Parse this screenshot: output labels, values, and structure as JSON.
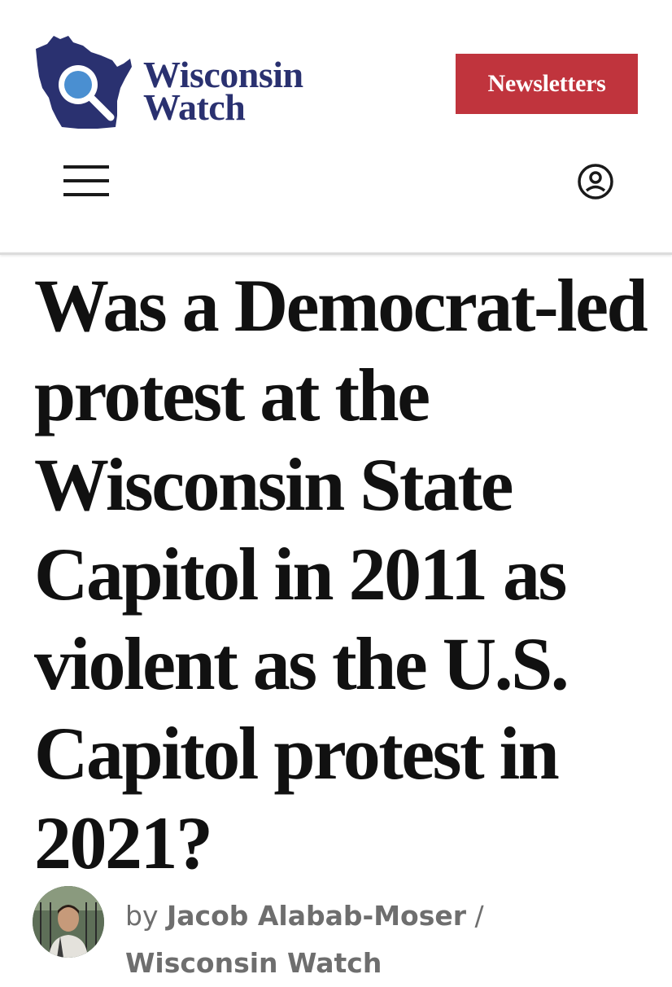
{
  "brand": {
    "line1": "Wisconsin",
    "line2": "Watch",
    "color": "#2a3170"
  },
  "header": {
    "newsletters_label": "Newsletters",
    "newsletters_color": "#c0343d",
    "menu_icon": "hamburger-menu-icon",
    "account_icon": "user-account-icon"
  },
  "article": {
    "headline": "Was a Democrat-led protest at the Wisconsin State Capitol in 2011 as violent as the U.S. Capitol protest in 2021?",
    "byline_prefix": "by",
    "author": "Jacob Alabab-Moser",
    "separator": "/",
    "organization": "Wisconsin Watch"
  }
}
